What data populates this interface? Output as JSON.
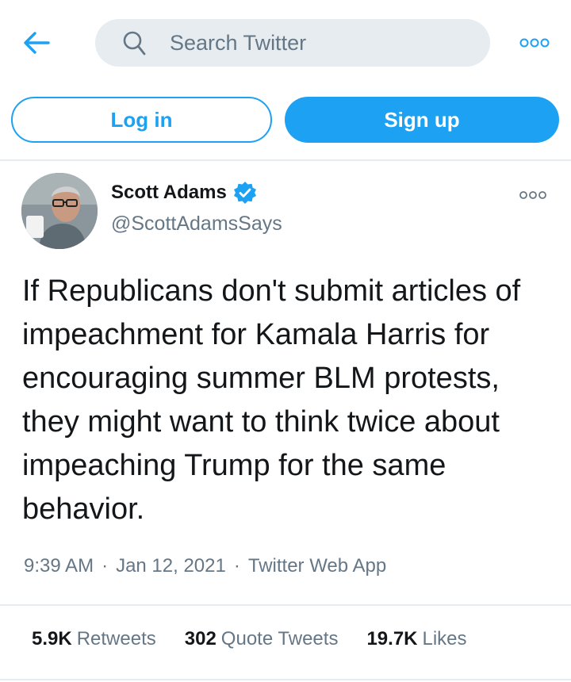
{
  "colors": {
    "accent": "#1da1f2",
    "text_primary": "#14171a",
    "text_secondary": "#657786",
    "search_bg": "#e6ecf0"
  },
  "header": {
    "back_icon": "arrow-left-icon",
    "search_placeholder": "Search Twitter",
    "search_icon": "search-icon",
    "more_icon": "more-horizontal-icon"
  },
  "auth": {
    "login_label": "Log in",
    "signup_label": "Sign up"
  },
  "tweet": {
    "author_name": "Scott Adams",
    "verified": true,
    "handle": "@ScottAdamsSays",
    "text": "If Republicans don't submit articles of impeachment for Kamala Harris for encouraging summer BLM protests, they might want to think twice about impeaching Trump for the same behavior.",
    "time": "9:39 AM",
    "date": "Jan 12, 2021",
    "source": "Twitter Web App",
    "separator": "·",
    "stats": {
      "retweets_count": "5.9K",
      "retweets_label": "Retweets",
      "quote_count": "302",
      "quote_label": "Quote Tweets",
      "likes_count": "19.7K",
      "likes_label": "Likes"
    }
  }
}
